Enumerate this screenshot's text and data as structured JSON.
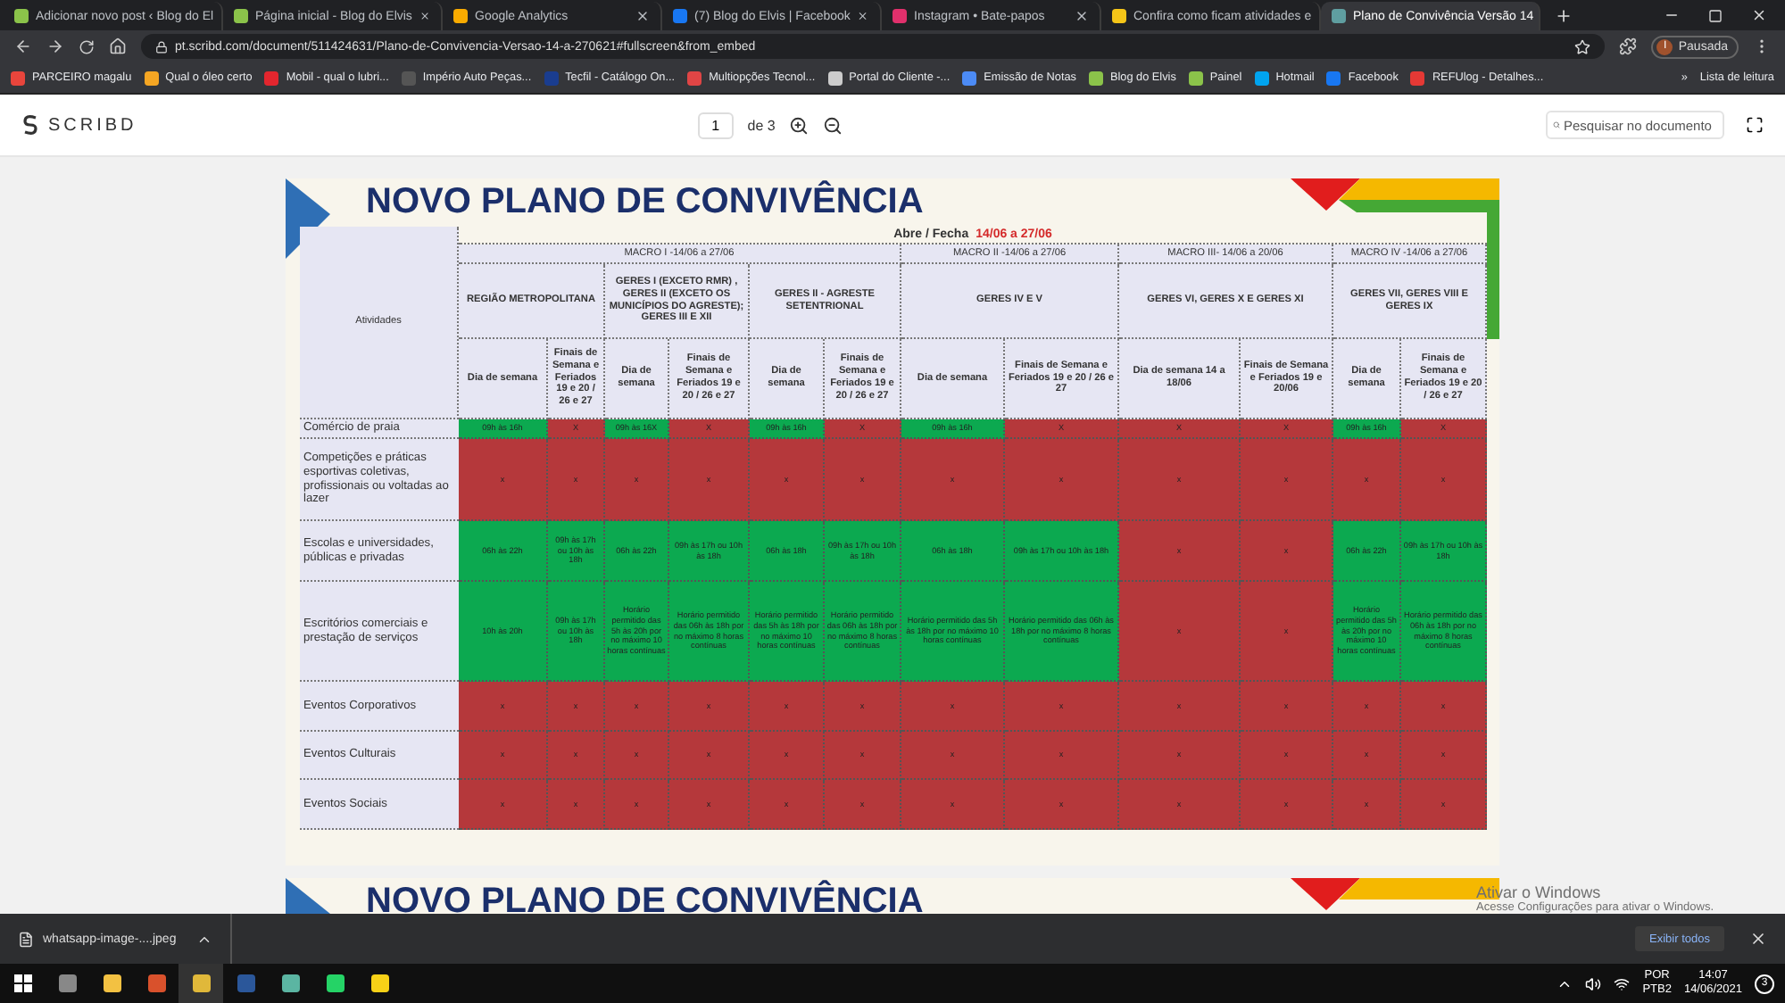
{
  "browser": {
    "tabs": [
      {
        "title": "Adicionar novo post ‹ Blog do El",
        "selected": false
      },
      {
        "title": "Página inicial - Blog do Elvis",
        "selected": false
      },
      {
        "title": "Google Analytics",
        "selected": false
      },
      {
        "title": "(7) Blog do Elvis | Facebook",
        "selected": false
      },
      {
        "title": "Instagram • Bate-papos",
        "selected": false
      },
      {
        "title": "Confira como ficam atividades e",
        "selected": false
      },
      {
        "title": "Plano de Convivência Versão 14",
        "selected": true
      }
    ],
    "address": "pt.scribd.com/document/511424631/Plano-de-Convivencia-Versao-14-a-270621#fullscreen&from_embed",
    "profile": "Pausada",
    "profile_initial": "I",
    "bookmarks": [
      "PARCEIRO magalu",
      "Qual o óleo certo",
      "Mobil - qual o lubri...",
      "Império Auto Peças...",
      "Tecfil - Catálogo On...",
      "Multiopções Tecnol...",
      "Portal do Cliente -...",
      "Emissão de Notas",
      "Blog do Elvis",
      "Painel",
      "Hotmail",
      "Facebook",
      "REFUlog - Detalhes..."
    ],
    "bookmarks_more": "»",
    "reading_list": "Lista de leitura"
  },
  "viewer": {
    "logo": "SCRIBD",
    "page": "1",
    "page_total": "de 3",
    "search_placeholder": "Pesquisar no documento"
  },
  "document": {
    "title": "NOVO PLANO DE CONVIVÊNCIA",
    "period_label": "Abre / Fecha",
    "period": "14/06 a 27/06",
    "activities_header": "Atividades",
    "macros": [
      {
        "label": "MACRO I -14/06 a 27/06",
        "regions": [
          {
            "name": "REGIÃO METROPOLITANA",
            "columns": [
              "Dia de semana",
              "Finais de Semana e Feriados 19 e 20 / 26 e 27"
            ]
          },
          {
            "name": "GERES I (EXCETO RMR) , GERES II (EXCETO OS MUNICÍPIOS DO AGRESTE); GERES III E XII",
            "columns": [
              "Dia de semana",
              "Finais de Semana e Feriados 19 e 20 / 26 e 27"
            ]
          },
          {
            "name": "GERES II - AGRESTE SETENTRIONAL",
            "columns": [
              "Dia de semana",
              "Finais de Semana e Feriados 19 e 20 / 26 e 27"
            ]
          }
        ]
      },
      {
        "label": "MACRO II -14/06 a 27/06",
        "regions": [
          {
            "name": "GERES IV E V",
            "columns": [
              "Dia de semana",
              "Finais de Semana e Feriados 19 e 20 / 26 e 27"
            ]
          }
        ]
      },
      {
        "label": "MACRO III- 14/06 a 20/06",
        "regions": [
          {
            "name": "GERES VI, GERES X  E GERES XI",
            "columns": [
              "Dia de semana 14 a 18/06",
              "Finais de Semana e Feriados 19 e 20/06"
            ]
          }
        ]
      },
      {
        "label": "MACRO IV -14/06 a 27/06",
        "regions": [
          {
            "name": "GERES VII, GERES VIII E GERES IX",
            "columns": [
              "Dia de semana",
              "Finais de Semana e Feriados 19 e 20 / 26 e 27"
            ]
          }
        ]
      }
    ],
    "rows": [
      {
        "activity": "Comércio de praia",
        "cells": [
          {
            "text": "09h às 16h",
            "open": true
          },
          {
            "text": "X",
            "open": false
          },
          {
            "text": "09h às 16X",
            "open": true
          },
          {
            "text": "X",
            "open": false
          },
          {
            "text": "09h às 16h",
            "open": true
          },
          {
            "text": "X",
            "open": false
          },
          {
            "text": "09h às 16h",
            "open": true
          },
          {
            "text": "X",
            "open": false
          },
          {
            "text": "X",
            "open": false
          },
          {
            "text": "X",
            "open": false
          },
          {
            "text": "09h às 16h",
            "open": true
          },
          {
            "text": "X",
            "open": false
          }
        ]
      },
      {
        "activity": "Competições e práticas esportivas coletivas, profissionais ou voltadas ao lazer",
        "cells": [
          {
            "text": "x",
            "open": false
          },
          {
            "text": "x",
            "open": false
          },
          {
            "text": "x",
            "open": false
          },
          {
            "text": "x",
            "open": false
          },
          {
            "text": "x",
            "open": false
          },
          {
            "text": "x",
            "open": false
          },
          {
            "text": "x",
            "open": false
          },
          {
            "text": "x",
            "open": false
          },
          {
            "text": "x",
            "open": false
          },
          {
            "text": "x",
            "open": false
          },
          {
            "text": "x",
            "open": false
          },
          {
            "text": "x",
            "open": false
          }
        ]
      },
      {
        "activity": "Escolas e universidades, públicas e privadas",
        "cells": [
          {
            "text": "06h às 22h",
            "open": true
          },
          {
            "text": "09h às 17h ou 10h às 18h",
            "open": true
          },
          {
            "text": "06h às 22h",
            "open": true
          },
          {
            "text": "09h às 17h ou 10h às 18h",
            "open": true
          },
          {
            "text": "06h às 18h",
            "open": true
          },
          {
            "text": "09h às 17h ou 10h às 18h",
            "open": true
          },
          {
            "text": "06h às 18h",
            "open": true
          },
          {
            "text": "09h às 17h ou 10h às 18h",
            "open": true
          },
          {
            "text": "x",
            "open": false
          },
          {
            "text": "x",
            "open": false
          },
          {
            "text": "06h às 22h",
            "open": true
          },
          {
            "text": "09h às 17h ou 10h às 18h",
            "open": true
          }
        ]
      },
      {
        "activity": "Escritórios comerciais e prestação de serviços",
        "cells": [
          {
            "text": "10h às 20h",
            "open": true
          },
          {
            "text": "09h às 17h ou 10h às 18h",
            "open": true
          },
          {
            "text": "Horário permitido das 5h às 20h por no máximo 10 horas contínuas",
            "open": true
          },
          {
            "text": "Horário permitido das 06h às 18h por no máximo 8 horas contínuas",
            "open": true
          },
          {
            "text": "Horário permitido das 5h às 18h por no máximo 10 horas contínuas",
            "open": true
          },
          {
            "text": "Horário permitido das 06h às 18h por no máximo 8 horas contínuas",
            "open": true
          },
          {
            "text": "Horário permitido das 5h às 18h por no máximo 10 horas contínuas",
            "open": true
          },
          {
            "text": "Horário permitido das 06h às 18h por no máximo 8 horas contínuas",
            "open": true
          },
          {
            "text": "x",
            "open": false
          },
          {
            "text": "x",
            "open": false
          },
          {
            "text": "Horário permitido das 5h às 20h por no máximo 10 horas contínuas",
            "open": true
          },
          {
            "text": "Horário permitido das 06h às 18h por no máximo 8 horas contínuas",
            "open": true
          }
        ]
      },
      {
        "activity": "Eventos Corporativos",
        "cells": [
          {
            "text": "x",
            "open": false
          },
          {
            "text": "x",
            "open": false
          },
          {
            "text": "x",
            "open": false
          },
          {
            "text": "x",
            "open": false
          },
          {
            "text": "x",
            "open": false
          },
          {
            "text": "x",
            "open": false
          },
          {
            "text": "x",
            "open": false
          },
          {
            "text": "x",
            "open": false
          },
          {
            "text": "x",
            "open": false
          },
          {
            "text": "x",
            "open": false
          },
          {
            "text": "x",
            "open": false
          },
          {
            "text": "x",
            "open": false
          }
        ]
      },
      {
        "activity": "Eventos Culturais",
        "cells": [
          {
            "text": "x",
            "open": false
          },
          {
            "text": "x",
            "open": false
          },
          {
            "text": "x",
            "open": false
          },
          {
            "text": "x",
            "open": false
          },
          {
            "text": "x",
            "open": false
          },
          {
            "text": "x",
            "open": false
          },
          {
            "text": "x",
            "open": false
          },
          {
            "text": "x",
            "open": false
          },
          {
            "text": "x",
            "open": false
          },
          {
            "text": "x",
            "open": false
          },
          {
            "text": "x",
            "open": false
          },
          {
            "text": "x",
            "open": false
          }
        ]
      },
      {
        "activity": "Eventos Sociais",
        "cells": [
          {
            "text": "x",
            "open": false
          },
          {
            "text": "x",
            "open": false
          },
          {
            "text": "x",
            "open": false
          },
          {
            "text": "x",
            "open": false
          },
          {
            "text": "x",
            "open": false
          },
          {
            "text": "x",
            "open": false
          },
          {
            "text": "x",
            "open": false
          },
          {
            "text": "x",
            "open": false
          },
          {
            "text": "x",
            "open": false
          },
          {
            "text": "x",
            "open": false
          },
          {
            "text": "x",
            "open": false
          },
          {
            "text": "x",
            "open": false
          }
        ]
      }
    ],
    "next_page_title": "NOVO PLANO DE CONVIVÊNCIA"
  },
  "os_notice": {
    "title": "Ativar o Windows",
    "text": "Acesse Configurações para ativar o Windows."
  },
  "downloads": {
    "file": "whatsapp-image-....jpeg",
    "show_all": "Exibir todos"
  },
  "taskbar": {
    "language": "POR",
    "layout": "PTB2",
    "time": "14:07",
    "date": "14/06/2021",
    "notifications": "3"
  }
}
